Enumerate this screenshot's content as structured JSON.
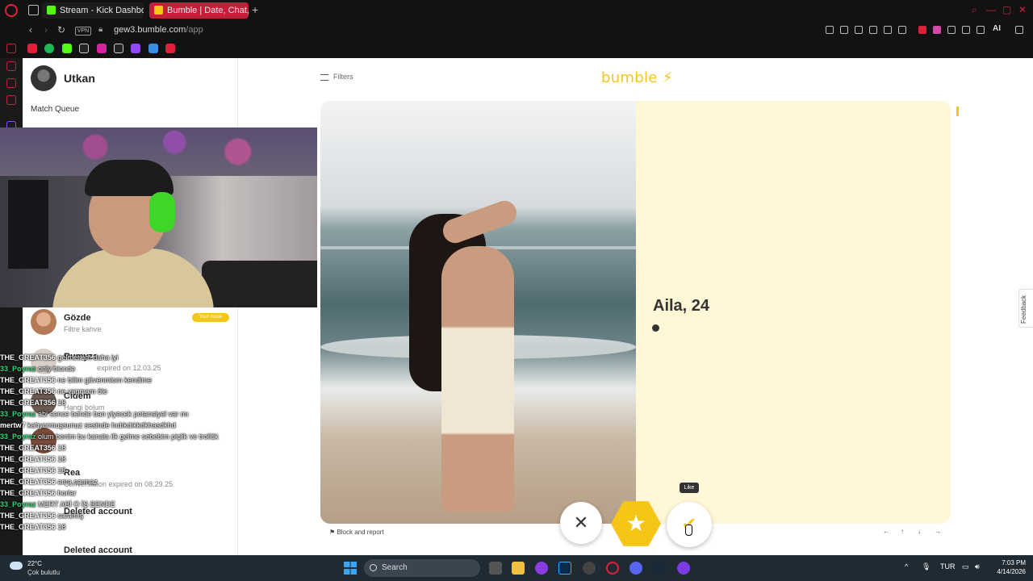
{
  "browser": {
    "tabs": [
      {
        "label": "Stream - Kick Dashboard",
        "color": "#53fc18"
      },
      {
        "label": "Bumble | Date, Chat, Meet",
        "color": "#f5c518"
      }
    ],
    "url_host": "gew3.bumble.com",
    "url_path": "/app",
    "vpn": "VPN",
    "ai": "AI"
  },
  "sidebar": {
    "user_name": "Utkan",
    "match_queue": "Match Queue"
  },
  "conversations": [
    {
      "name": "Gözde",
      "subtitle": "Filtre kahve",
      "badge": "Your move"
    },
    {
      "name": "Rumyza",
      "subtitle": "expired on 12.03.25"
    },
    {
      "name": "Cidem",
      "subtitle": "Hangi bolum"
    },
    {
      "name": "Rea",
      "subtitle": "Conversation expired on 08.29.25"
    },
    {
      "name": "Deleted account",
      "subtitle": ""
    },
    {
      "name": "Deleted account",
      "subtitle": ""
    }
  ],
  "chat": [
    {
      "user": "THE_GREAT356",
      "msg": "gelmesem daha iyi",
      "green": false
    },
    {
      "user": "33_Poyraz",
      "msg": "only blonde",
      "green": true
    },
    {
      "user": "THE_GREAT356",
      "msg": "ne bilim güvenmiom kendime",
      "green": false
    },
    {
      "user": "THE_GREAT356",
      "msg": "ne yapmam öle",
      "green": false
    },
    {
      "user": "THE_GREAT356",
      "msg": "18",
      "green": false
    },
    {
      "user": "33_Poyraz",
      "msg": "abi sence bende ban yiyecek potansiyel var mı",
      "green": true
    },
    {
      "user": "mertw7",
      "msg": "kahyormuşsunuz sesinde hıdıkdıkkdkhasdkhd",
      "green": false
    },
    {
      "user": "33_Poyraz",
      "msg": "olum benim bu kanala ilk gelme sebebim piçlik ve trollük",
      "green": true
    },
    {
      "user": "THE_GREAT356",
      "msg": "18",
      "green": false
    },
    {
      "user": "THE_GREAT356",
      "msg": "18",
      "green": false
    },
    {
      "user": "THE_GREAT356",
      "msg": "18",
      "green": false
    },
    {
      "user": "THE_GREAT356",
      "msg": "ama sarmaz",
      "green": false
    },
    {
      "user": "THE_GREAT356",
      "msg": "horlar",
      "green": false
    },
    {
      "user": "33_Poyraz",
      "msg": "MERT ABİ O İŞ BENDE",
      "green": true
    },
    {
      "user": "THE_GREAT356",
      "msg": "saramış",
      "green": false
    },
    {
      "user": "THE_GREAT356",
      "msg": "18",
      "green": false
    }
  ],
  "main": {
    "filters": "Filters",
    "logo": "bumble",
    "profile_name": "Aila, 24",
    "block_report": "Block and report",
    "like_tooltip": "Like",
    "feedback": "Feedback",
    "arrows": [
      "←",
      "↑",
      "↓",
      "→"
    ]
  },
  "taskbar": {
    "temp": "22°C",
    "weather": "Çok bulutlu",
    "search": "Search",
    "lang": "TUR",
    "time": "7:03 PM",
    "date": "4/14/2026"
  }
}
